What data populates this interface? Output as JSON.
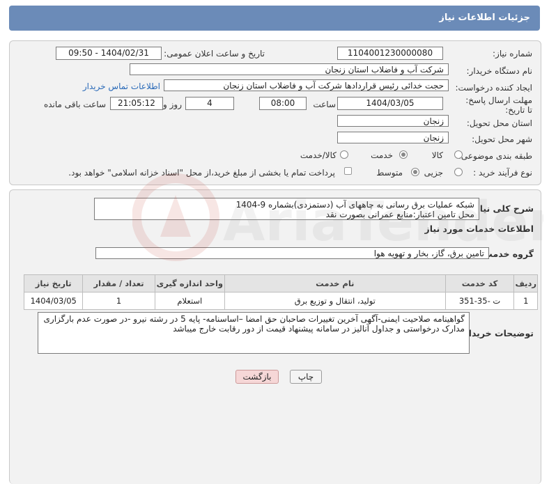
{
  "header": {
    "title": "جزئیات اطلاعات نیاز"
  },
  "form": {
    "need_number_label": "شماره نیاز:",
    "need_number": "1104001230000080",
    "announce_label": "تاریخ و ساعت اعلان عمومی:",
    "announce_value": "1404/02/31 - 09:50",
    "buyer_org_label": "نام دستگاه خریدار:",
    "buyer_org": "شرکت آب و فاضلاب استان زنجان",
    "creator_label": "ایجاد کننده درخواست:",
    "creator": "حجت  خدائی رئیس قراردادها شرکت آب و فاضلاب استان زنجان",
    "contact_link": "اطلاعات تماس خریدار",
    "deadline_label": "مهلت ارسال پاسخ: تا تاریخ:",
    "deadline_date": "1404/03/05",
    "time_label": "ساعت",
    "deadline_time": "08:00",
    "days_value": "4",
    "days_label": "روز و",
    "remaining_time": "21:05:12",
    "remaining_label": "ساعت باقی مانده",
    "province_label": "استان محل تحویل:",
    "province": "زنجان",
    "city_label": "شهر محل تحویل:",
    "city": "زنجان",
    "category_label": "طبقه بندی موضوعی:",
    "category_options": [
      "کالا",
      "خدمت",
      "کالا/خدمت"
    ],
    "process_label": "نوع فرآیند خرید :",
    "process_options": [
      "جزیی",
      "متوسط"
    ],
    "payment_note": "پرداخت تمام یا بخشی از مبلغ خرید،از محل \"اسناد خزانه اسلامی\" خواهد بود."
  },
  "summary": {
    "label": "شرح کلی نیاز:",
    "line1": "شبکه عملیات برق رسانی به چاههای آب (دستمزدی)بشماره 9-1404",
    "line2": "محل تامین اعتبار:منابع عمرانی بصورت نقد"
  },
  "services": {
    "section_title": "اطلاعات خدمات مورد نیاز",
    "group_label": "گروه خدمت:",
    "group_value": "تامین برق، گاز، بخار و تهویه هوا",
    "columns": [
      "ردیف",
      "کد خدمت",
      "نام خدمت",
      "واحد اندازه گیری",
      "تعداد / مقدار",
      "تاریخ نیاز"
    ],
    "rows": [
      {
        "row": "1",
        "code": "ت -35-351",
        "name": "تولید، انتقال و توزیع برق",
        "unit": "استعلام",
        "qty": "1",
        "date": "1404/03/05"
      }
    ]
  },
  "buyer_notes": {
    "label": "توضیحات خریدار:",
    "line1": "گواهینامه صلاحیت ایمنی-آگهی آخرین تغییرات صاحبان حق امضا –اساسنامه- پایه 5 در  رشته نیرو -در صورت عدم بارگزاری",
    "line2": "مدارک درخواستی و جداول آنالیز در سامانه پیشنهاد قیمت از دور رقابت خارج میباشد"
  },
  "buttons": {
    "print": "چاپ",
    "back": "بازگشت"
  },
  "watermark_text": "AriaTender.neT"
}
